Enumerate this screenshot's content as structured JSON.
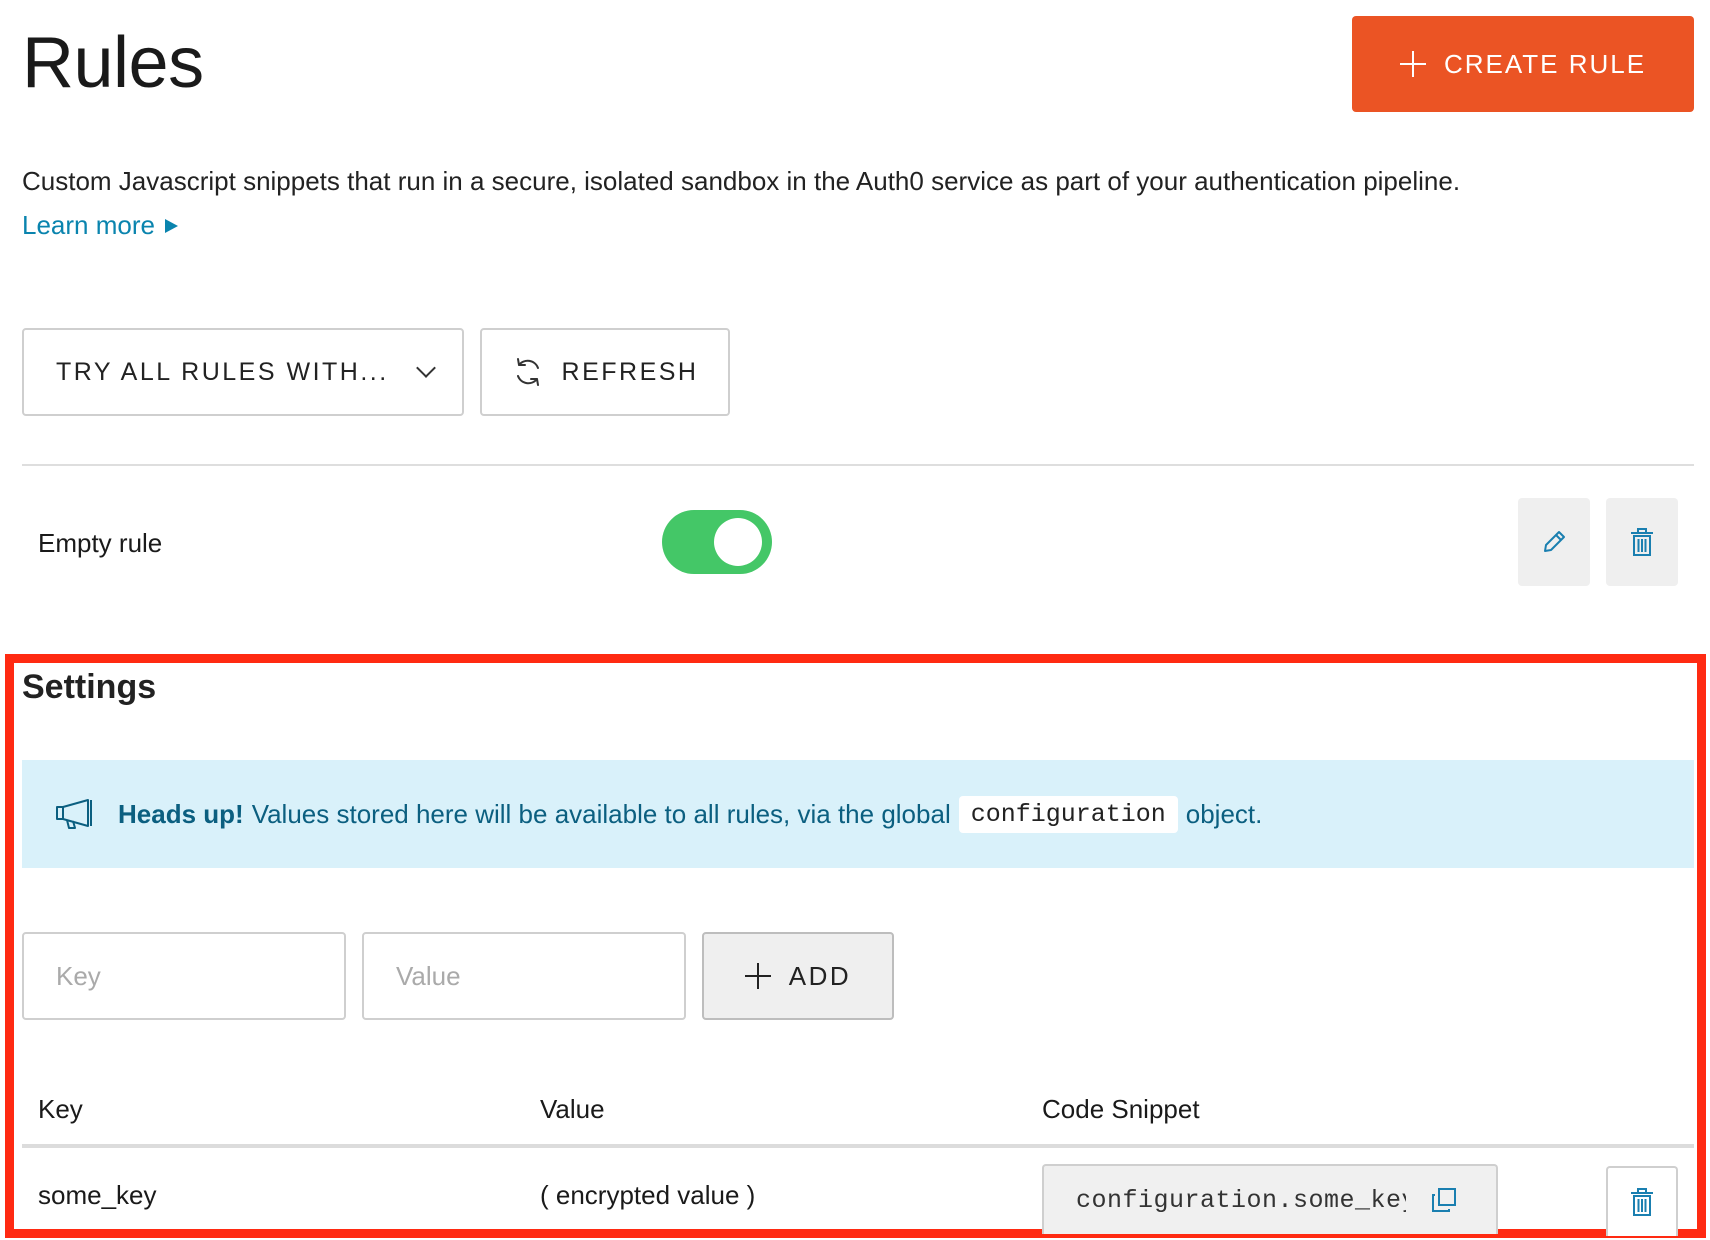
{
  "header": {
    "title": "Rules",
    "create_button": "CREATE RULE"
  },
  "intro": {
    "description": "Custom Javascript snippets that run in a secure, isolated sandbox in the Auth0 service as part of your authentication pipeline.",
    "learn_more": "Learn more"
  },
  "toolbar": {
    "try_all": "TRY ALL RULES WITH...",
    "refresh": "REFRESH"
  },
  "rules": [
    {
      "name": "Empty rule",
      "enabled": true
    }
  ],
  "settings": {
    "title": "Settings",
    "alert": {
      "strong": "Heads up!",
      "text_before": "Values stored here will be available to all rules, via the global",
      "code": "configuration",
      "text_after": "object."
    },
    "key_placeholder": "Key",
    "value_placeholder": "Value",
    "add_button": "ADD",
    "columns": {
      "key": "Key",
      "value": "Value",
      "snippet": "Code Snippet"
    },
    "rows": [
      {
        "key": "some_key",
        "value": "( encrypted value )",
        "snippet": "configuration.some_key"
      }
    ]
  },
  "colors": {
    "accent": "#eb5424",
    "link": "#0a84ae",
    "toggle_on": "#44c767",
    "alert_bg": "#d9f1fa",
    "highlight_frame": "#ff2a12"
  },
  "icons": [
    "plus-icon",
    "chevron-down-icon",
    "refresh-icon",
    "pencil-icon",
    "trash-icon",
    "megaphone-icon",
    "copy-icon"
  ]
}
